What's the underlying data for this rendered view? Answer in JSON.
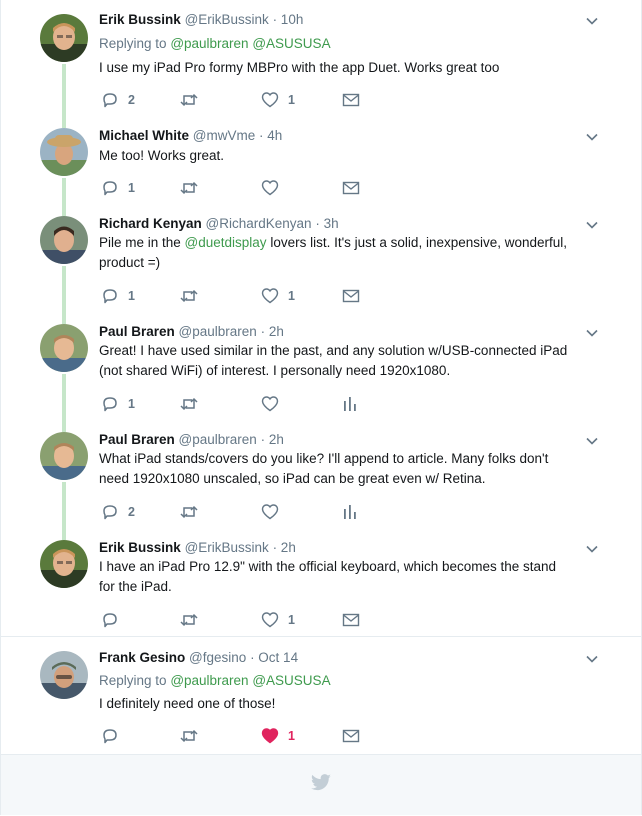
{
  "tweets": [
    {
      "name": "Erik Bussink",
      "handle": "@ErikBussink",
      "time": "· 10h",
      "replying_prefix": "Replying to",
      "replying_to": [
        "@paulbraren",
        "@ASUSUSA"
      ],
      "text": "I use my iPad Pro formy MBPro with the app Duet. Works great too",
      "replies": "2",
      "likes": "1",
      "last_action": "dm",
      "liked": false
    },
    {
      "name": "Michael White",
      "handle": "@mwVme",
      "time": "· 4h",
      "text": "Me too!  Works great.",
      "replies": "1",
      "likes": "",
      "last_action": "dm",
      "liked": false
    },
    {
      "name": "Richard Kenyan",
      "handle": "@RichardKenyan",
      "time": "· 3h",
      "text_before": "Pile me in the ",
      "text_mention": "@duetdisplay",
      "text_after": " lovers list. It's just a solid, inexpensive, wonderful, product =)",
      "replies": "1",
      "likes": "1",
      "last_action": "dm",
      "liked": false
    },
    {
      "name": "Paul Braren",
      "handle": "@paulbraren",
      "time": "· 2h",
      "text": "Great! I have used similar in the past, and any solution w/USB-connected iPad (not shared WiFi) of interest. I personally need 1920x1080.",
      "replies": "1",
      "likes": "",
      "last_action": "analytics",
      "liked": false
    },
    {
      "name": "Paul Braren",
      "handle": "@paulbraren",
      "time": "· 2h",
      "text": "What iPad stands/covers do you like? I'll append to article. Many folks don't need 1920x1080 unscaled, so iPad can be great even w/ Retina.",
      "replies": "2",
      "likes": "",
      "last_action": "analytics",
      "liked": false
    },
    {
      "name": "Erik Bussink",
      "handle": "@ErikBussink",
      "time": "· 2h",
      "text": "I have an iPad Pro 12.9\" with the official keyboard, which becomes the stand for the iPad.",
      "replies": "",
      "likes": "1",
      "last_action": "dm",
      "liked": false
    },
    {
      "name": "Frank Gesino",
      "handle": "@fgesino",
      "time": "· Oct 14",
      "replying_prefix": "Replying to",
      "replying_to": [
        "@paulbraren",
        "@ASUSUSA"
      ],
      "text": "I definitely need one of those!",
      "replies": "",
      "likes": "1",
      "last_action": "dm",
      "liked": true
    }
  ],
  "icons": {
    "reply": "reply-icon",
    "retweet": "retweet-icon",
    "like": "heart-icon",
    "dm": "envelope-icon",
    "analytics": "analytics-icon",
    "more": "chevron-down-icon",
    "footer": "twitter-bird-icon"
  },
  "colors": {
    "accent_link": "#3e9a4d",
    "thread_line": "#c6e6c9",
    "muted": "#657786",
    "liked": "#e0245e",
    "footer_bg": "#f5f8fa"
  }
}
